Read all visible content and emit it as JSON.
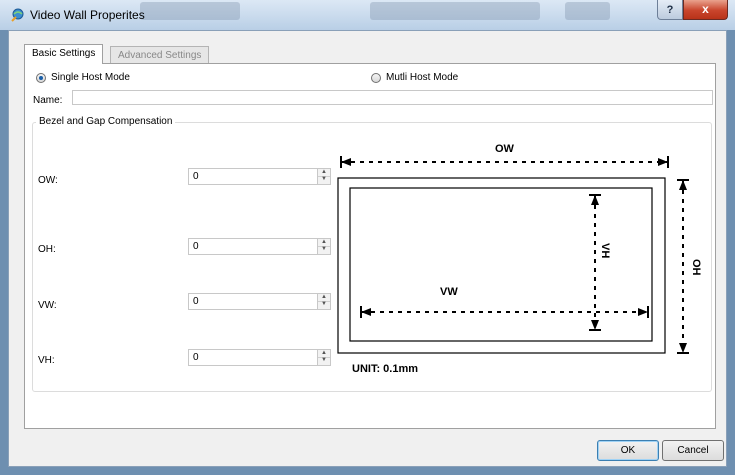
{
  "window": {
    "title": "Video Wall Properites"
  },
  "titlebar_buttons": {
    "help": "?",
    "close": "x"
  },
  "tabs": [
    {
      "label": "Basic Settings",
      "active": true
    },
    {
      "label": "Advanced Settings",
      "active": false
    }
  ],
  "mode": {
    "single": {
      "label": "Single Host Mode",
      "selected": true
    },
    "multi": {
      "label": "Mutli Host Mode",
      "selected": false
    }
  },
  "name_field": {
    "label": "Name:",
    "value": ""
  },
  "bezel_group": {
    "title": "Bezel and Gap Compensation",
    "fields": [
      {
        "label": "OW:",
        "value": "0"
      },
      {
        "label": "OH:",
        "value": "0"
      },
      {
        "label": "VW:",
        "value": "0"
      },
      {
        "label": "VH:",
        "value": "0"
      }
    ]
  },
  "diagram": {
    "ow_label": "OW",
    "oh_label": "OH",
    "vw_label": "VW",
    "vh_label": "VH",
    "unit": "UNIT: 0.1mm"
  },
  "buttons": {
    "ok": "OK",
    "cancel": "Cancel"
  },
  "icons": {
    "app": "app-globe-icon",
    "help": "help-icon",
    "close": "close-icon"
  }
}
